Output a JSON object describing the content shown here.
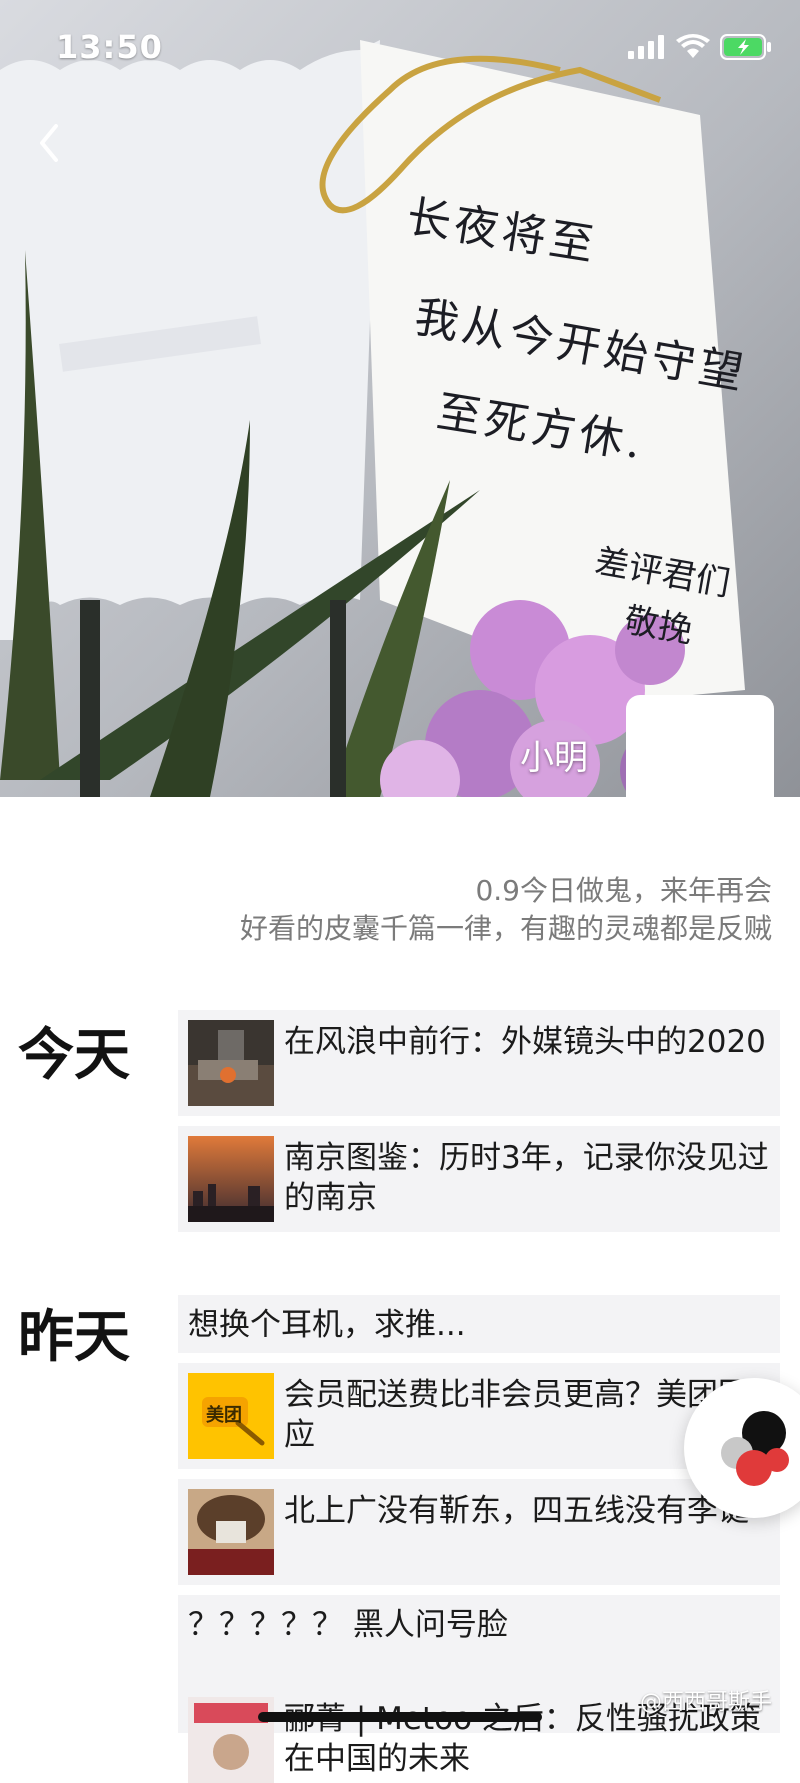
{
  "status_bar": {
    "time": "13:50",
    "icons": [
      "cellular-signal-icon",
      "wifi-icon",
      "battery-charging-icon"
    ],
    "battery_color": "#4cd964"
  },
  "cover": {
    "card_text_lines": [
      "长夜将至",
      "我从今开始守望",
      "至死方休."
    ],
    "card_signature_lines": [
      "差评君们",
      "敬挽"
    ]
  },
  "profile": {
    "nickname": "小明",
    "signature_lines": [
      "0.9今日做鬼，来年再会",
      "好看的皮囊千篇一律，有趣的灵魂都是反贼"
    ]
  },
  "sections": [
    {
      "label": "今天",
      "posts": [
        {
          "title": "在风浪中前行：外媒镜头中的2020",
          "thumb": "news-photo-icon"
        },
        {
          "title": "南京图鉴：历时3年，记录你没见过的南京",
          "thumb": "city-skyline-icon"
        }
      ]
    },
    {
      "label": "昨天",
      "posts": [
        {
          "title": "想换个耳机，求推..."
        },
        {
          "title": "会员配送费比非会员更高？美团回应",
          "thumb": "meituan-logo-icon",
          "thumb_text": "美团"
        },
        {
          "title": "北上广没有靳东，四五线没有李诞",
          "thumb": "portrait-photo-icon"
        },
        {
          "title": "？？？？？ 黑人问号脸"
        },
        {
          "title": "郦菁 | Metoo 之后：反性骚扰政策在中国的未来",
          "thumb": "event-photo-icon"
        }
      ]
    }
  ],
  "watermark": "@西西哥斯手",
  "colors": {
    "post_bg": "#f3f3f5",
    "signature_text": "#7b7b7b",
    "meituan_yellow": "#ffc300"
  }
}
